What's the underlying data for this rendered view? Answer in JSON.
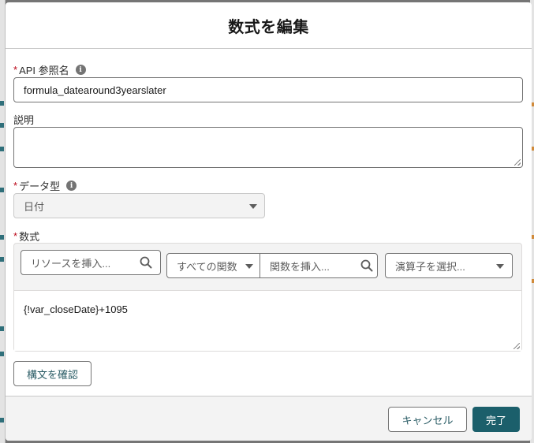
{
  "modal": {
    "title": "数式を編集"
  },
  "fields": {
    "api_name": {
      "required_mark": "*",
      "label": "API 参照名",
      "info_icon": "info-icon",
      "value": "formula_datearound3yearslater"
    },
    "description": {
      "label": "説明",
      "value": ""
    },
    "data_type": {
      "required_mark": "*",
      "label": "データ型",
      "info_icon": "info-icon",
      "selected": "日付"
    },
    "formula": {
      "required_mark": "*",
      "label": "数式",
      "resource_search_placeholder": "リソースを挿入...",
      "function_category": "すべての関数",
      "function_search_placeholder": "関数を挿入...",
      "operator_placeholder": "演算子を選択...",
      "expression": "{!var_closeDate}+1095"
    }
  },
  "buttons": {
    "check_syntax": "構文を確認",
    "cancel": "キャンセル",
    "done": "完了"
  },
  "colors": {
    "brand_button": "#1b5f6b",
    "required": "#ba0517",
    "link_text": "#2b5d66"
  }
}
